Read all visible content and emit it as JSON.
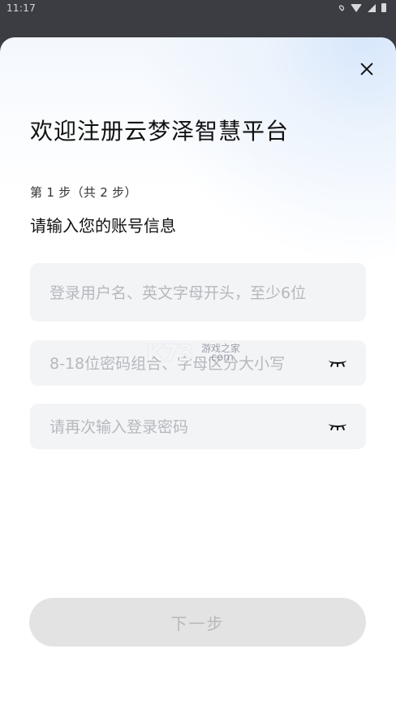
{
  "status_bar": {
    "time": "11:17",
    "icons": [
      "location-icon",
      "wifi-icon",
      "signal-icon",
      "battery-icon"
    ]
  },
  "header": {
    "close_icon": "close-icon"
  },
  "page": {
    "title": "欢迎注册云梦泽智慧平台",
    "step_label": "第 1 步（共 2 步）",
    "section_title": "请输入您的账号信息"
  },
  "form": {
    "username": {
      "value": "",
      "placeholder": "登录用户名、英文字母开头，至少6位"
    },
    "password": {
      "value": "",
      "placeholder": "8-18位密码组合、字母区分大小写",
      "toggle_icon": "eye-closed-icon"
    },
    "confirm_password": {
      "value": "",
      "placeholder": "请再次输入登录密码",
      "toggle_icon": "eye-closed-icon"
    },
    "next_label": "下一步"
  },
  "watermark": {
    "logo": "K73",
    "text": "游戏之家",
    "sub": ".com"
  },
  "colors": {
    "background_dim": "#3b3d42",
    "field_background": "#f3f4f6",
    "placeholder": "#b6b8bd",
    "button_disabled_bg": "#e3e3e3",
    "button_disabled_text": "#b8b8b8"
  }
}
